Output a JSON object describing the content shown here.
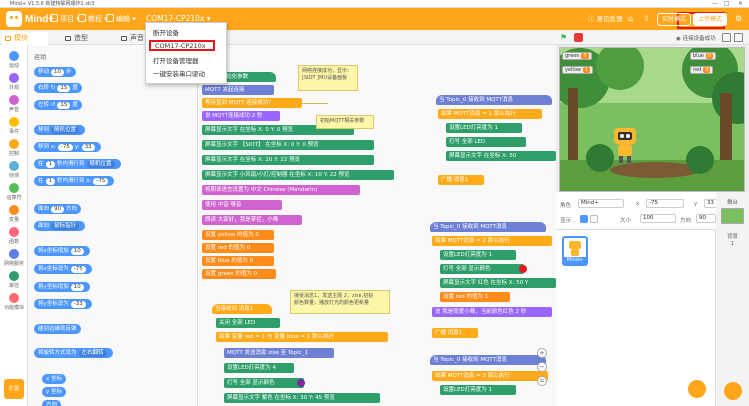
{
  "window": {
    "title": "Mind+ V1.5.6   新建物联网爆炸2.sb3",
    "min": "—",
    "max": "□",
    "close": "✕"
  },
  "menubar": {
    "logo": "Mind+",
    "items": [
      "项目",
      "教程",
      "编辑"
    ],
    "device": "COM17-CP210x",
    "feedback": "意见反馈",
    "mode_live": "实时模式",
    "mode_upload": "上传模式"
  },
  "dropdown": {
    "items": [
      "断开设备",
      "COM17-CP210x",
      "打开设备管理器",
      "一键安装串口驱动"
    ]
  },
  "tabs": {
    "blocks": "模块",
    "costumes": "造型",
    "sounds": "声音"
  },
  "stage_toolbar": {
    "conn": "连接设备成功"
  },
  "categories": [
    {
      "label": "运动",
      "color": "#4c97ff"
    },
    {
      "label": "外观",
      "color": "#9966ff"
    },
    {
      "label": "声音",
      "color": "#cf63cf"
    },
    {
      "label": "事件",
      "color": "#ffbf00"
    },
    {
      "label": "控制",
      "color": "#ffab19"
    },
    {
      "label": "侦测",
      "color": "#5cb1d6"
    },
    {
      "label": "运算符",
      "color": "#59c059"
    },
    {
      "label": "变量",
      "color": "#ff8c1a"
    },
    {
      "label": "函数",
      "color": "#ff6680"
    },
    {
      "label": "网络服务",
      "color": "#5a7fe6"
    },
    {
      "label": "掌控",
      "color": "#2e9e6a"
    },
    {
      "label": "功能模块",
      "color": "#ff6b6b"
    }
  ],
  "palette": {
    "heading": "运动",
    "blocks": [
      {
        "pre": "移动",
        "in": "10",
        "post": "步"
      },
      {
        "pre": "右转 ↻",
        "in": "15",
        "post": "度"
      },
      {
        "pre": "左转 ↺",
        "in": "15",
        "post": "度"
      },
      {
        "pre": "移到",
        "dr": "随机位置",
        "post": ""
      },
      {
        "pre": "移到 x:",
        "in": "-75",
        "post": "y:",
        "in2": "33"
      },
      {
        "pre": "在",
        "in": "1",
        "post": "秒内滑行到",
        "dr": "随机位置"
      },
      {
        "pre": "在",
        "in": "1",
        "post": "秒内滑行到 x:",
        "in2": "-75"
      },
      {
        "pre": "面向",
        "in": "90",
        "post": "方向"
      },
      {
        "pre": "面向",
        "dr": "鼠标指针",
        "post": ""
      },
      {
        "pre": "将x坐标增加",
        "in": "10",
        "post": ""
      },
      {
        "pre": "将x坐标设为",
        "in": "-75",
        "post": ""
      },
      {
        "pre": "将y坐标增加",
        "in": "10",
        "post": ""
      },
      {
        "pre": "将y坐标设为",
        "in": "-33",
        "post": ""
      },
      {
        "pre": "碰到边缘就反弹",
        "post": ""
      },
      {
        "pre": "将旋转方式设为",
        "dr": "左右翻转",
        "post": ""
      },
      {
        "pre": "x 坐标",
        "post": ""
      },
      {
        "pre": "y 坐标",
        "post": ""
      },
      {
        "pre": "方向",
        "post": ""
      }
    ]
  },
  "scripts": {
    "s1_hat": "Mind+ 初始化参数",
    "s1": [
      "MQTT 发起连接",
      "等待直到  MQTT 连接成功?",
      "说  MQTT连接成功  2 秒",
      "屏幕显示文字     在坐标 X: 0  Y: 0  预览",
      "屏幕显示文字  【SIOT】  在坐标 X: 0  Y: 0  预览",
      "屏幕显示文字    在坐标 X: 20  Y: 22  预览",
      "屏幕显示文字  小风扇/小灯/控制器  在坐标 X: 10  Y: 22  预览",
      "将朗读语言设置为  中文 Chinese (Mandarin)",
      "使用  中音  嗓音",
      "朗读  大家好，我是掌控，小蓦",
      "设置 yellow 的值为 0",
      "设置 red 的值为 0",
      "设置 blue 的值为 0",
      "设置 green 的值为 0"
    ],
    "c1": "网络连接成功，显示：\n[SIOT ]MU设备面板",
    "c2": "初始MQTT相关参数",
    "s2": [
      "当  Topic_0  接收到  MQTT消息",
      "如果  MQTT消息  =  1  那么执行",
      "设置LED灯亮度为  1",
      "灯号  全部  LED",
      "屏幕显示文字    在坐标 X: 50",
      "广播  消息1"
    ],
    "s3": [
      "当  Topic_0  接收到  MQTT消息",
      "如果  MQTT消息  =  2  那么执行",
      "设置LED灯亮度为  1",
      "灯号  全部  显示颜色",
      "屏幕显示文字  红色  在坐标 X: 50 Y",
      "设置 red 的值为  1",
      "说  我是雨爱小蓦，当前颜色红色  2  秒",
      "广播  消息1"
    ],
    "s4": [
      "当  Topic_0  接收到  MQTT消息",
      "如果  MQTT消息  =  3  那么执行",
      "设置LED灯亮度为  1"
    ],
    "s5_hat": "当接收到  消息1",
    "s5": [
      "关闭  全部  LED",
      "如果  变量 red  =  1  与  变量 blue  =  1  那么执行",
      "MQTT 发送消息  zise  至  Topic_1",
      "设置LED灯亮度为  4",
      "灯号  全部  显示颜色",
      "屏幕显示文字  紫色  在坐标 X: 30  Y: 45  预览"
    ],
    "c3": "接受消息1，发送主题 2，zise,初始\n颜色数量，播放灯光的颜色更新量",
    "zoom_in": "+",
    "zoom_out": "−",
    "zoom_reset": "="
  },
  "stage": {
    "monitors": [
      {
        "label": "green",
        "value": "0"
      },
      {
        "label": "yellow",
        "value": "1"
      },
      {
        "label": "blue",
        "value": "0"
      },
      {
        "label": "red",
        "value": "0"
      }
    ]
  },
  "sprite_info": {
    "role_label": "角色",
    "name": "Mind+",
    "x_label": "x",
    "x": "-75",
    "y_label": "y",
    "y": "33",
    "show_label": "显示",
    "size_label": "大小",
    "size": "100",
    "dir_label": "方向",
    "dir": "90",
    "stage_label": "舞台",
    "backdrop_label": "背景",
    "backdrop_count": "1"
  },
  "sprites": [
    {
      "name": "Mind+"
    }
  ]
}
